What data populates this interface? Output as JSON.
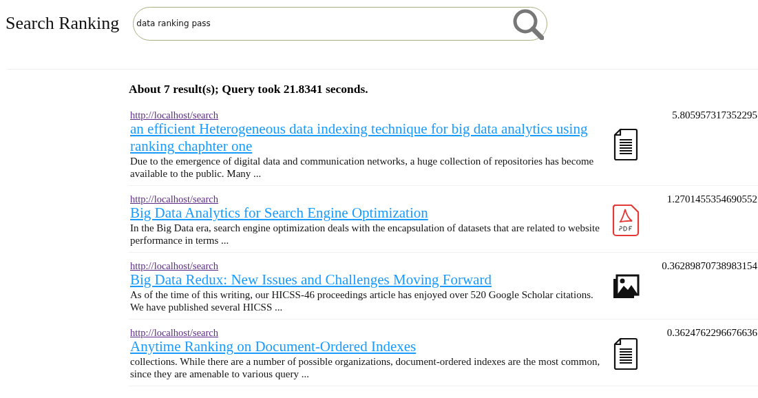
{
  "header": {
    "title": "Search Ranking",
    "search": {
      "value": "data ranking pass"
    }
  },
  "summary": "About 7 result(s); Query took 21.8341 seconds.",
  "results": [
    {
      "url": "http://localhost/search",
      "title": "an efficient Heterogeneous data indexing technique for big data analytics using ranking chaphter one",
      "snippet": "Due to the emergence of digital data and communication networks, a huge collection of repositories has become available to the public. Many ...",
      "kind": "document",
      "score": "5.805957317352295"
    },
    {
      "url": "http://localhost/search",
      "title": "Big Data Analytics for Search Engine Optimization",
      "snippet": "In the Big Data era, search engine optimization deals with the encapsulation of datasets that are related to website performance in terms ...",
      "kind": "pdf",
      "score": "1.2701455354690552"
    },
    {
      "url": "http://localhost/search",
      "title": "Big Data Redux: New Issues and Challenges Moving Forward",
      "snippet": "As of the time of this writing, our HICSS-46 proceedings article has enjoyed over 520 Google Scholar citations. We have published several HICSS ...",
      "kind": "image",
      "score": "0.36289870738983154"
    },
    {
      "url": "http://localhost/search",
      "title": "Anytime Ranking on Document-Ordered Indexes",
      "snippet": "collections. While there are a number of possible organizations, document-ordered indexes are the most common, since they are amenable to various query ...",
      "kind": "document",
      "score": "0.3624762296676636"
    }
  ]
}
